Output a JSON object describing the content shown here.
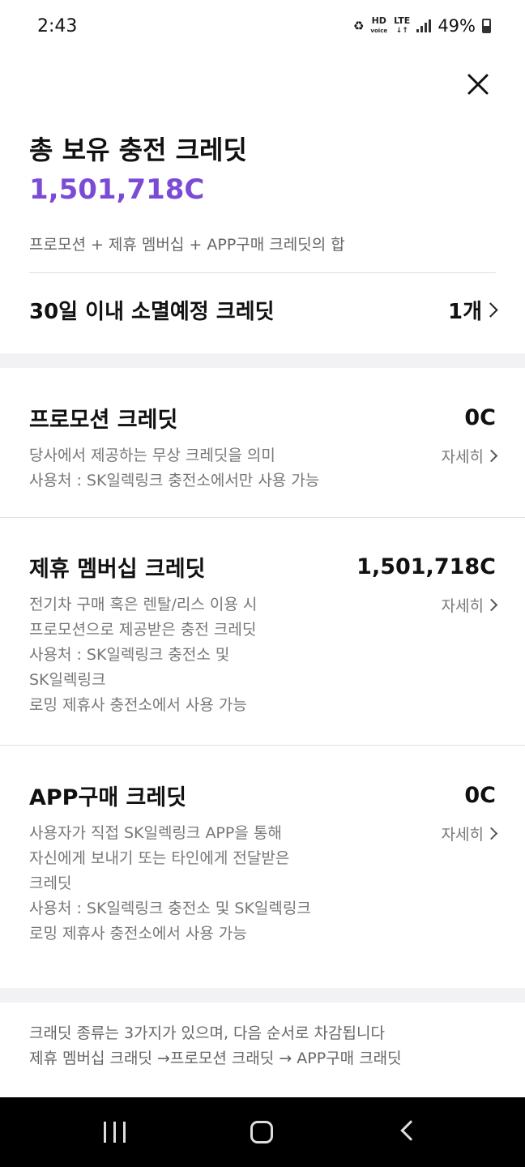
{
  "status_bar": {
    "time": "2:43",
    "battery": "49%",
    "hd_label": "HD",
    "voice_label": "voice",
    "lte_label": "LTE"
  },
  "summary": {
    "title": "총 보유 충전 크레딧",
    "amount": "1,501,718C",
    "amount_color": "#7b4bd6",
    "description": "프로모션 + 제휴 멤버십 + APP구매 크레딧의 합",
    "expire_label": "30일 이내 소멸예정 크레딧",
    "expire_count": "1개"
  },
  "sections": [
    {
      "title": "프로모션 크레딧",
      "value": "0C",
      "link": "자세히",
      "lines": [
        "당사에서 제공하는 무상 크레딧을 의미",
        "사용처 : SK일렉링크 충전소에서만 사용 가능"
      ]
    },
    {
      "title": "제휴 멤버십 크레딧",
      "value": "1,501,718C",
      "link": "자세히",
      "lines": [
        "전기차 구매 혹은 렌탈/리스 이용 시",
        "프로모션으로 제공받은 충전 크레딧",
        "사용처 : SK일렉링크 충전소 및",
        "SK일렉링크",
        "로밍 제휴사 충전소에서 사용 가능"
      ]
    },
    {
      "title": "APP구매 크레딧",
      "value": "0C",
      "link": "자세히",
      "lines": [
        "사용자가 직접 SK일렉링크 APP을 통해",
        "자신에게 보내기 또는 타인에게 전달받은",
        "크레딧",
        "사용처 : SK일렉링크 충전소 및 SK일렉링크",
        "로밍 제휴사 충전소에서 사용 가능"
      ]
    }
  ],
  "footer": {
    "line1": "크래딧 종류는 3가지가 있으며, 다음 순서로 차감됩니다",
    "line2": "제휴 멤버십 크래딧 →프로모션 크래딧 → APP구매 크래딧"
  }
}
